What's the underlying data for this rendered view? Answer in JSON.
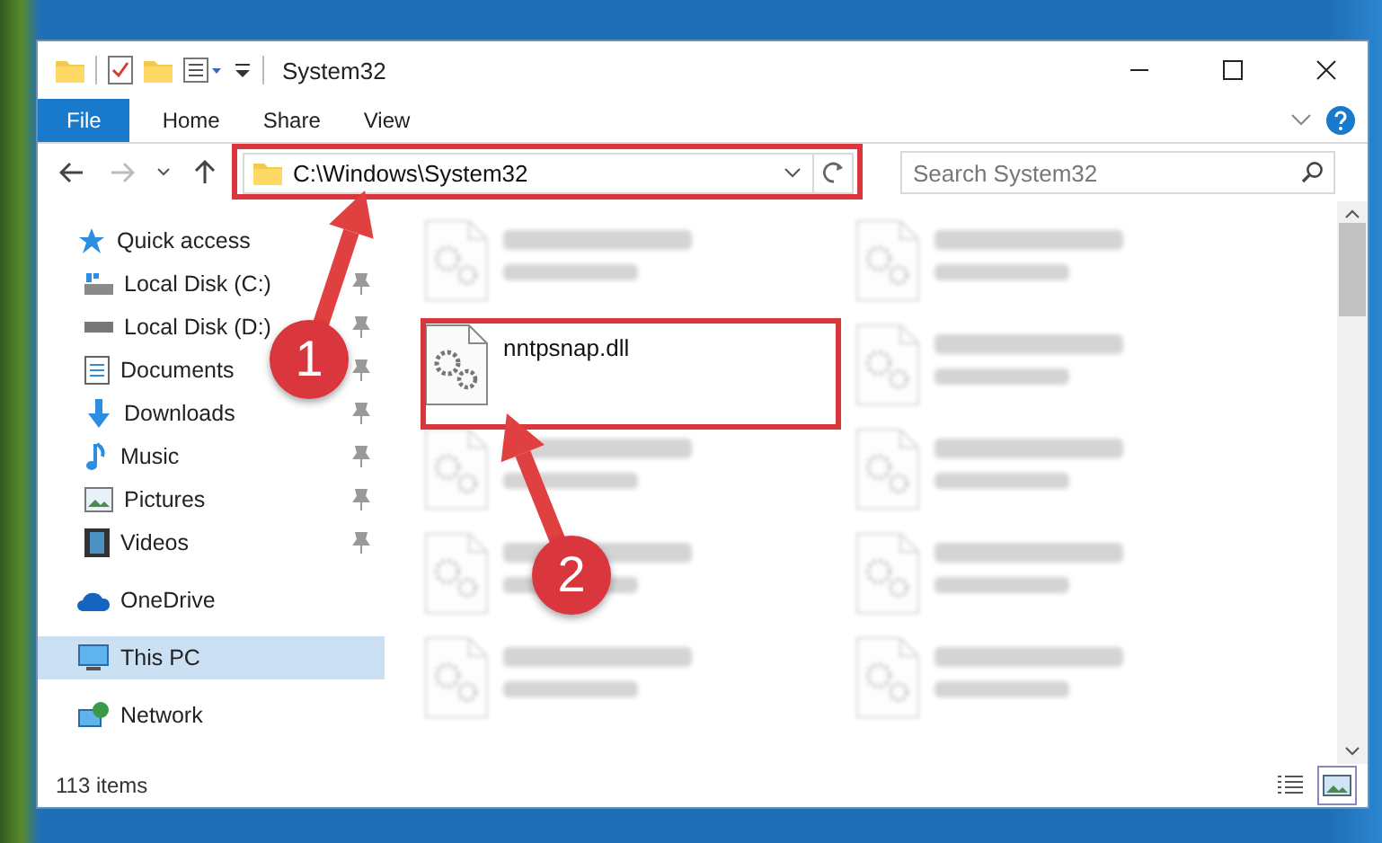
{
  "window": {
    "title": "System32"
  },
  "ribbon": {
    "tabs": [
      {
        "label": "File",
        "kind": "file"
      },
      {
        "label": "Home",
        "kind": "tab"
      },
      {
        "label": "Share",
        "kind": "tab"
      },
      {
        "label": "View",
        "kind": "tab"
      }
    ]
  },
  "address": {
    "path": "C:\\Windows\\System32"
  },
  "search": {
    "placeholder": "Search System32"
  },
  "navigation": [
    {
      "label": "Quick access",
      "kind": "star",
      "selected": false,
      "children": [
        {
          "label": "Local Disk (C:)",
          "kind": "drive-c",
          "pinned": true,
          "selected": false
        },
        {
          "label": "Local Disk (D:)",
          "kind": "drive",
          "pinned": true,
          "selected": false
        },
        {
          "label": "Documents",
          "kind": "documents",
          "pinned": true,
          "selected": false
        },
        {
          "label": "Downloads",
          "kind": "downloads",
          "pinned": true,
          "selected": false
        },
        {
          "label": "Music",
          "kind": "music",
          "pinned": true,
          "selected": false
        },
        {
          "label": "Pictures",
          "kind": "pictures",
          "pinned": true,
          "selected": false
        },
        {
          "label": "Videos",
          "kind": "videos",
          "pinned": true,
          "selected": false
        }
      ]
    },
    {
      "label": "OneDrive",
      "kind": "cloud",
      "selected": false
    },
    {
      "label": "This PC",
      "kind": "pc",
      "selected": true
    },
    {
      "label": "Network",
      "kind": "network",
      "selected": false
    }
  ],
  "files": [
    {
      "kind": "blurred"
    },
    {
      "kind": "blurred"
    },
    {
      "name": "nntpsnap.dll",
      "kind": "clear"
    },
    {
      "kind": "blurred"
    },
    {
      "kind": "blurred"
    },
    {
      "kind": "blurred"
    },
    {
      "kind": "blurred"
    },
    {
      "kind": "blurred"
    },
    {
      "kind": "blurred"
    },
    {
      "kind": "blurred"
    }
  ],
  "status_bar": {
    "item_count": "113 items"
  },
  "annotations": [
    {
      "number": "1",
      "kind": "address"
    },
    {
      "number": "2",
      "kind": "file"
    }
  ]
}
